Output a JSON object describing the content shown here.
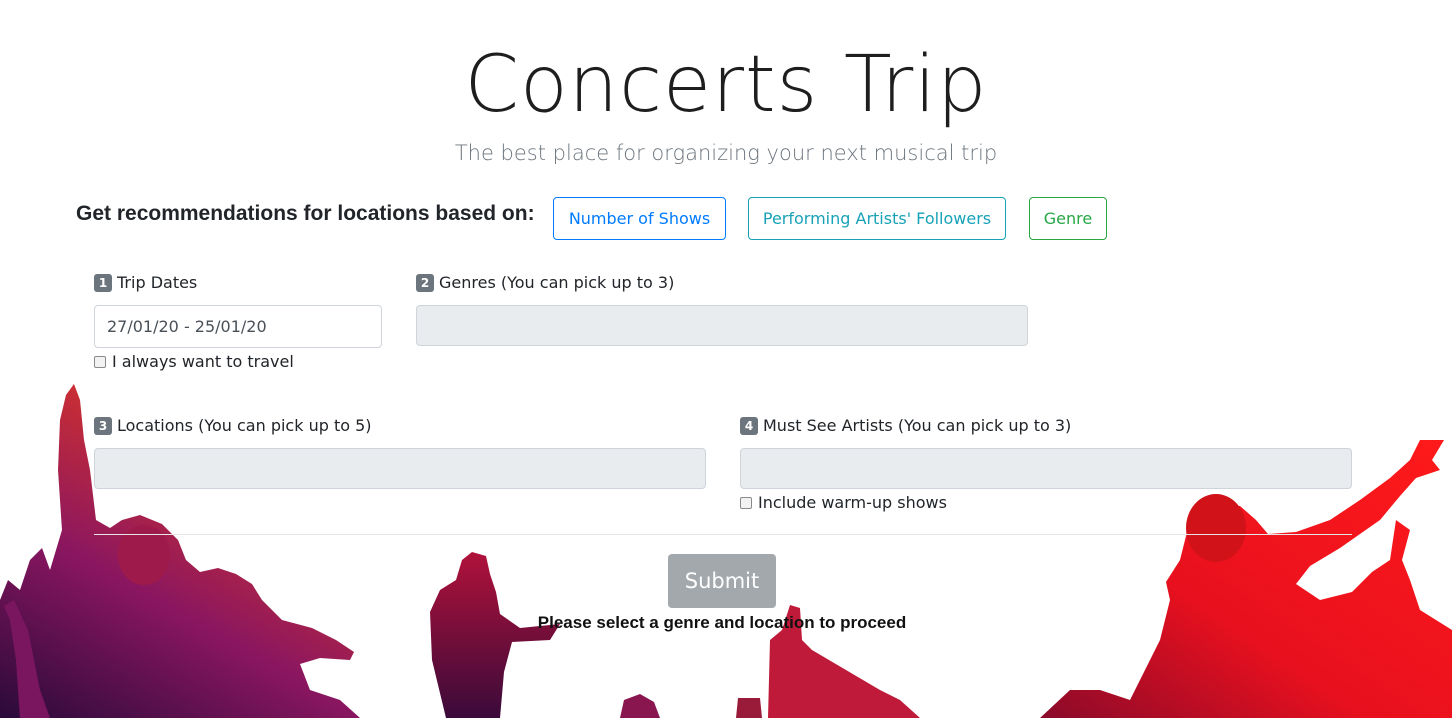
{
  "header": {
    "title": "Concerts Trip",
    "subtitle": "The best place for organizing your next musical trip"
  },
  "recommendations": {
    "label": "Get recommendations for locations based on:",
    "buttons": [
      {
        "label": "Number of Shows",
        "color": "#007bff"
      },
      {
        "label": "Performing Artists' Followers",
        "color": "#17a2b8"
      },
      {
        "label": "Genre",
        "color": "#28a745"
      }
    ]
  },
  "form": {
    "trip_dates": {
      "step": "1",
      "label": "Trip Dates",
      "value": "27/01/20 - 25/01/20",
      "always_travel_label": "I always want to travel"
    },
    "genres": {
      "step": "2",
      "label": "Genres (You can pick up to 3)"
    },
    "locations": {
      "step": "3",
      "label": "Locations (You can pick up to 5)"
    },
    "must_see": {
      "step": "4",
      "label": "Must See Artists (You can pick up to 3)",
      "warmup_label": "Include warm-up shows"
    }
  },
  "submit": {
    "label": "Submit",
    "message": "Please select a genre and location to proceed"
  },
  "colors": {
    "art_gradient": [
      "#2a0a3a",
      "#8a1660",
      "#e81e2a",
      "#ff1a1a"
    ]
  }
}
